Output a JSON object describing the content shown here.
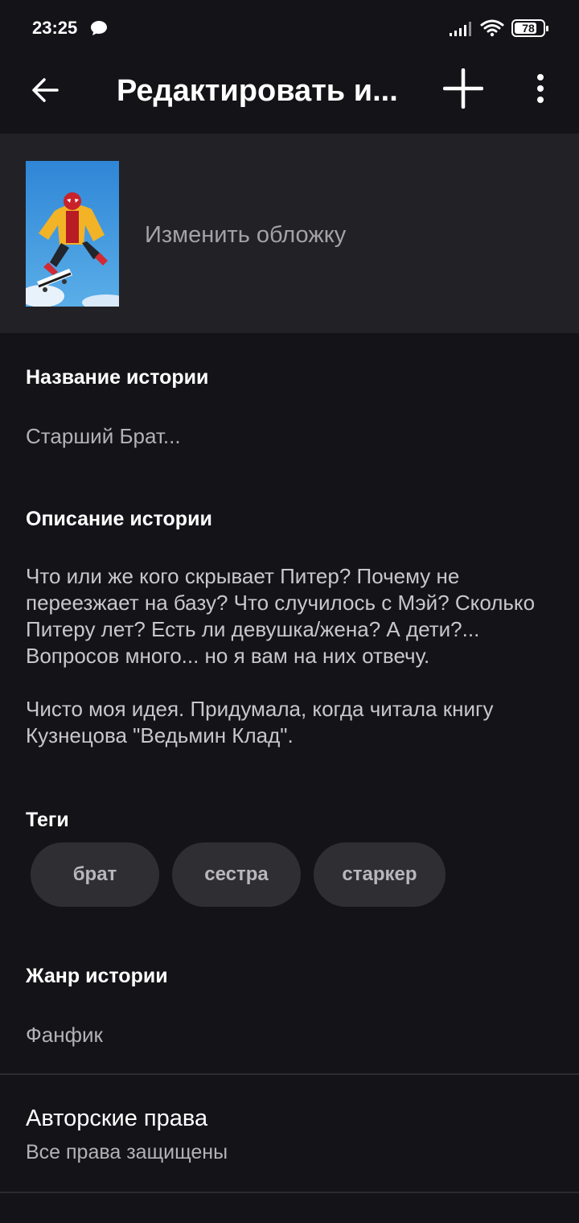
{
  "status_bar": {
    "time": "23:25",
    "battery": "78",
    "battery_level": 0.78,
    "icons": [
      "message-icon",
      "signal-icon",
      "wifi-icon",
      "battery-icon"
    ]
  },
  "app_bar": {
    "title": "Редактировать и...",
    "icons": [
      "back-arrow-icon",
      "plus-icon",
      "more-vert-icon"
    ]
  },
  "cover": {
    "change_label": "Изменить обложку"
  },
  "story": {
    "title_label": "Название истории",
    "title_value": "Старший Брат...",
    "description_label": "Описание истории",
    "description_p1": "Что или же кого скрывает Питер? Почему не переезжает на базу? Что случилось с Мэй? Сколько Питеру лет? Есть ли девушка/жена? А дети?... Вопросов много... но я вам на них отвечу.",
    "description_p2": "Чисто моя идея. Придумала, когда читала книгу Кузнецова \"Ведьмин Клад\".",
    "tags_label": "Теги",
    "tags": [
      "брат",
      "сестра",
      "старкер"
    ],
    "genre_label": "Жанр истории",
    "genre_value": "Фанфик",
    "copyright_label": "Авторские права",
    "copyright_value": "Все права защищены"
  },
  "colors": {
    "background": "#141317",
    "cover_section": "#222126",
    "tag_background": "#2f2e33"
  }
}
